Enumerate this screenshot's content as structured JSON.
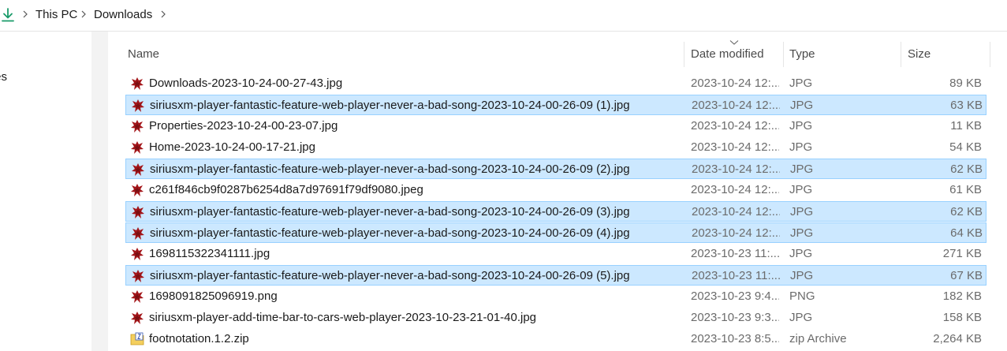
{
  "breadcrumb": {
    "icon": "download-arrow-icon",
    "items": [
      "This PC",
      "Downloads"
    ]
  },
  "nav": {
    "partial_item": "ofiles"
  },
  "columns": {
    "name": "Name",
    "date": "Date modified",
    "type": "Type",
    "size": "Size"
  },
  "colors": {
    "selected_bg": "#cce8ff",
    "selected_border": "#99d1ff",
    "download_icon": "#1a9b6a"
  },
  "files": [
    {
      "name": "Downloads-2023-10-24-00-27-43.jpg",
      "date": "2023-10-24 12:...",
      "type": "JPG",
      "size": "89 KB",
      "selected": false,
      "icon": "image-file-icon"
    },
    {
      "name": "siriusxm-player-fantastic-feature-web-player-never-a-bad-song-2023-10-24-00-26-09 (1).jpg",
      "date": "2023-10-24 12:...",
      "type": "JPG",
      "size": "63 KB",
      "selected": true,
      "icon": "image-file-icon"
    },
    {
      "name": "Properties-2023-10-24-00-23-07.jpg",
      "date": "2023-10-24 12:...",
      "type": "JPG",
      "size": "11 KB",
      "selected": false,
      "icon": "image-file-icon"
    },
    {
      "name": "Home-2023-10-24-00-17-21.jpg",
      "date": "2023-10-24 12:...",
      "type": "JPG",
      "size": "54 KB",
      "selected": false,
      "icon": "image-file-icon"
    },
    {
      "name": "siriusxm-player-fantastic-feature-web-player-never-a-bad-song-2023-10-24-00-26-09 (2).jpg",
      "date": "2023-10-24 12:...",
      "type": "JPG",
      "size": "62 KB",
      "selected": true,
      "icon": "image-file-icon"
    },
    {
      "name": "c261f846cb9f0287b6254d8a7d97691f79df9080.jpeg",
      "date": "2023-10-24 12:...",
      "type": "JPG",
      "size": "61 KB",
      "selected": false,
      "icon": "image-file-icon"
    },
    {
      "name": "siriusxm-player-fantastic-feature-web-player-never-a-bad-song-2023-10-24-00-26-09 (3).jpg",
      "date": "2023-10-24 12:...",
      "type": "JPG",
      "size": "62 KB",
      "selected": true,
      "icon": "image-file-icon"
    },
    {
      "name": "siriusxm-player-fantastic-feature-web-player-never-a-bad-song-2023-10-24-00-26-09 (4).jpg",
      "date": "2023-10-24 12:...",
      "type": "JPG",
      "size": "64 KB",
      "selected": true,
      "icon": "image-file-icon"
    },
    {
      "name": "1698115322341111.jpg",
      "date": "2023-10-23 11:...",
      "type": "JPG",
      "size": "271 KB",
      "selected": false,
      "icon": "image-file-icon"
    },
    {
      "name": "siriusxm-player-fantastic-feature-web-player-never-a-bad-song-2023-10-24-00-26-09 (5).jpg",
      "date": "2023-10-23 11:...",
      "type": "JPG",
      "size": "67 KB",
      "selected": true,
      "icon": "image-file-icon"
    },
    {
      "name": "1698091825096919.png",
      "date": "2023-10-23 9:4...",
      "type": "PNG",
      "size": "182 KB",
      "selected": false,
      "icon": "image-file-icon"
    },
    {
      "name": "siriusxm-player-add-time-bar-to-cars-web-player-2023-10-23-21-01-40.jpg",
      "date": "2023-10-23 9:3...",
      "type": "JPG",
      "size": "158 KB",
      "selected": false,
      "icon": "image-file-icon"
    },
    {
      "name": "footnotation.1.2.zip",
      "date": "2023-10-23 8:5...",
      "type": "zip Archive",
      "size": "2,264 KB",
      "selected": false,
      "icon": "zip-file-icon"
    }
  ]
}
